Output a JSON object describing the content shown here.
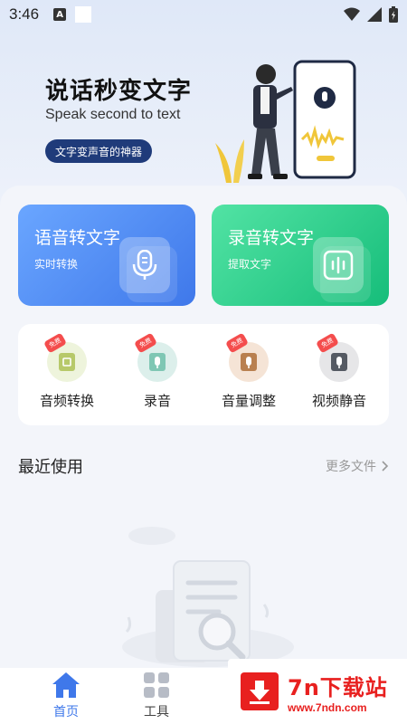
{
  "status_bar": {
    "time": "3:46",
    "a_icon": "A"
  },
  "hero": {
    "title": "说话秒变文字",
    "subtitle": "Speak second to text",
    "tag": "文字变声音的神器"
  },
  "feature_cards": [
    {
      "title": "语音转文字",
      "subtitle": "实时转换",
      "icon": "microphone-icon",
      "color": "#4f8cf5"
    },
    {
      "title": "录音转文字",
      "subtitle": "提取文字",
      "icon": "waveform-icon",
      "color": "#22c886"
    }
  ],
  "tools": [
    {
      "label": "音频转换",
      "badge": "免费",
      "icon": "audio-convert-icon"
    },
    {
      "label": "录音",
      "badge": "免费",
      "icon": "record-icon"
    },
    {
      "label": "音量调整",
      "badge": "免费",
      "icon": "volume-icon"
    },
    {
      "label": "视频静音",
      "badge": "免费",
      "icon": "video-mute-icon"
    }
  ],
  "recent": {
    "title": "最近使用",
    "more_label": "更多文件"
  },
  "tabbar": [
    {
      "label": "首页",
      "active": true,
      "icon": "home-icon"
    },
    {
      "label": "工具",
      "active": false,
      "icon": "grid-icon"
    }
  ],
  "watermark": {
    "title": "7n下载站",
    "url": "www.7ndn.com"
  },
  "colors": {
    "primary": "#3f78ea",
    "green": "#16bd7a",
    "active_tab": "#3f78ea",
    "watermark": "#e8201f"
  }
}
